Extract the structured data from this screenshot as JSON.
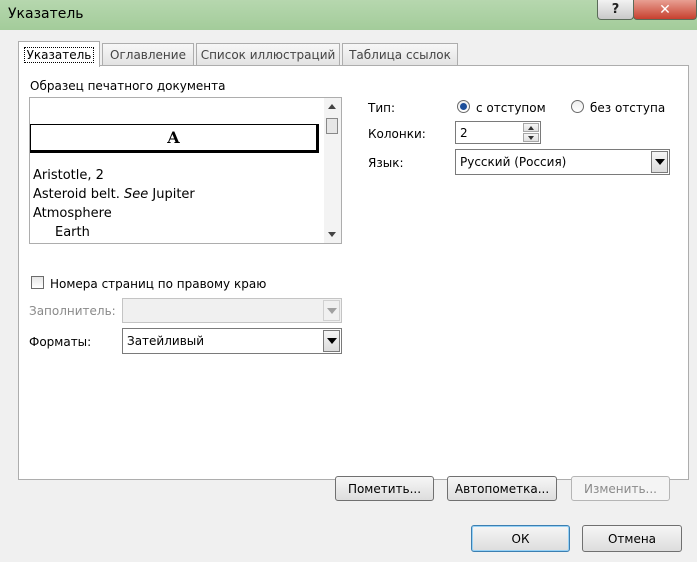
{
  "window": {
    "title": "Указатель",
    "help_glyph": "?",
    "close_glyph": "✕"
  },
  "tabs": [
    {
      "label": "Указатель"
    },
    {
      "label": "Оглавление"
    },
    {
      "label": "Список иллюстраций"
    },
    {
      "label": "Таблица ссылок"
    }
  ],
  "preview": {
    "label": "Образец печатного документа",
    "letter": "A",
    "entries": [
      {
        "text": "Aristotle, 2"
      },
      {
        "text_before": "Asteroid belt. ",
        "text_italic": "See",
        "text_after": " Jupiter"
      },
      {
        "text": "Atmosphere"
      },
      {
        "text": "Earth"
      }
    ]
  },
  "type_group": {
    "label": "Тип:",
    "option_indent": "с отступом",
    "option_run_in": "без отступа",
    "selected": "с отступом"
  },
  "columns": {
    "label": "Колонки:",
    "value": "2"
  },
  "language": {
    "label": "Язык:",
    "value": "Русский (Россия)"
  },
  "right_align": {
    "label": "Номера страниц по правому краю",
    "checked": false
  },
  "tab_leader": {
    "label": "Заполнитель:",
    "value": ""
  },
  "formats": {
    "label": "Форматы:",
    "value": "Затейливый"
  },
  "buttons": {
    "mark": "Пометить...",
    "automark": "Автопометка...",
    "modify": "Изменить...",
    "ok": "ОК",
    "cancel": "Отмена"
  }
}
